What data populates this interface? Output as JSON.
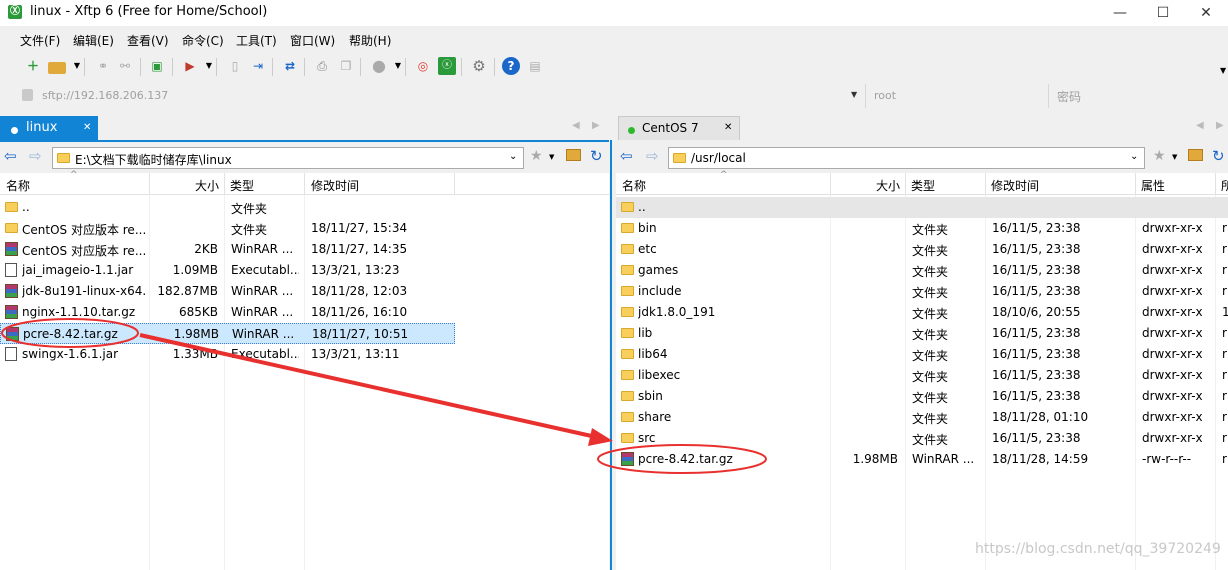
{
  "window": {
    "title": "linux - Xftp 6 (Free for Home/School)",
    "minimize": "—",
    "maximize": "☐",
    "close": "✕"
  },
  "menu": [
    "文件(F)",
    "编辑(E)",
    "查看(V)",
    "命令(C)",
    "工具(T)",
    "窗口(W)",
    "帮助(H)"
  ],
  "address": {
    "url": "sftp://192.168.206.137",
    "user": "root",
    "password_placeholder": "密码"
  },
  "left": {
    "tab": "linux",
    "path": "E:\\文档下载临时储存库\\linux",
    "columns": [
      "名称",
      "大小",
      "类型",
      "修改时间"
    ],
    "rows": [
      {
        "icon": "folder",
        "name": "..",
        "size": "",
        "type": "文件夹",
        "date": ""
      },
      {
        "icon": "folder",
        "name": "CentOS 对应版本 re...",
        "size": "",
        "type": "文件夹",
        "date": "18/11/27, 15:34"
      },
      {
        "icon": "rar",
        "name": "CentOS 对应版本 re...",
        "size": "2KB",
        "type": "WinRAR ...",
        "date": "18/11/27, 14:35"
      },
      {
        "icon": "jar",
        "name": "jai_imageio-1.1.jar",
        "size": "1.09MB",
        "type": "Executabl...",
        "date": "13/3/21, 13:23"
      },
      {
        "icon": "rar",
        "name": "jdk-8u191-linux-x64...",
        "size": "182.87MB",
        "type": "WinRAR ...",
        "date": "18/11/28, 12:03"
      },
      {
        "icon": "rar",
        "name": "nginx-1.1.10.tar.gz",
        "size": "685KB",
        "type": "WinRAR ...",
        "date": "18/11/26, 16:10"
      },
      {
        "icon": "rar",
        "name": "pcre-8.42.tar.gz",
        "size": "1.98MB",
        "type": "WinRAR ...",
        "date": "18/11/27, 10:51"
      },
      {
        "icon": "jar",
        "name": "swingx-1.6.1.jar",
        "size": "1.33MB",
        "type": "Executabl...",
        "date": "13/3/21, 13:11"
      }
    ]
  },
  "right": {
    "tab": "CentOS 7",
    "path": "/usr/local",
    "columns": [
      "名称",
      "大小",
      "类型",
      "修改时间",
      "属性",
      "所"
    ],
    "rows": [
      {
        "icon": "folder",
        "name": "..",
        "size": "",
        "type": "",
        "date": "",
        "attr": "",
        "owner": ""
      },
      {
        "icon": "folder",
        "name": "bin",
        "size": "",
        "type": "文件夹",
        "date": "16/11/5, 23:38",
        "attr": "drwxr-xr-x",
        "owner": "r"
      },
      {
        "icon": "folder",
        "name": "etc",
        "size": "",
        "type": "文件夹",
        "date": "16/11/5, 23:38",
        "attr": "drwxr-xr-x",
        "owner": "r"
      },
      {
        "icon": "folder",
        "name": "games",
        "size": "",
        "type": "文件夹",
        "date": "16/11/5, 23:38",
        "attr": "drwxr-xr-x",
        "owner": "r"
      },
      {
        "icon": "folder",
        "name": "include",
        "size": "",
        "type": "文件夹",
        "date": "16/11/5, 23:38",
        "attr": "drwxr-xr-x",
        "owner": "r"
      },
      {
        "icon": "folder",
        "name": "jdk1.8.0_191",
        "size": "",
        "type": "文件夹",
        "date": "18/10/6, 20:55",
        "attr": "drwxr-xr-x",
        "owner": "1"
      },
      {
        "icon": "folder",
        "name": "lib",
        "size": "",
        "type": "文件夹",
        "date": "16/11/5, 23:38",
        "attr": "drwxr-xr-x",
        "owner": "r"
      },
      {
        "icon": "folder",
        "name": "lib64",
        "size": "",
        "type": "文件夹",
        "date": "16/11/5, 23:38",
        "attr": "drwxr-xr-x",
        "owner": "r"
      },
      {
        "icon": "folder",
        "name": "libexec",
        "size": "",
        "type": "文件夹",
        "date": "16/11/5, 23:38",
        "attr": "drwxr-xr-x",
        "owner": "r"
      },
      {
        "icon": "folder",
        "name": "sbin",
        "size": "",
        "type": "文件夹",
        "date": "16/11/5, 23:38",
        "attr": "drwxr-xr-x",
        "owner": "r"
      },
      {
        "icon": "folder",
        "name": "share",
        "size": "",
        "type": "文件夹",
        "date": "18/11/28, 01:10",
        "attr": "drwxr-xr-x",
        "owner": "r"
      },
      {
        "icon": "folder",
        "name": "src",
        "size": "",
        "type": "文件夹",
        "date": "16/11/5, 23:38",
        "attr": "drwxr-xr-x",
        "owner": "r"
      },
      {
        "icon": "rar",
        "name": "pcre-8.42.tar.gz",
        "size": "1.98MB",
        "type": "WinRAR ...",
        "date": "18/11/28, 14:59",
        "attr": "-rw-r--r--",
        "owner": "r"
      }
    ]
  },
  "watermark": "https://blog.csdn.net/qq_39720249",
  "colors": {
    "accent": "#1184d6",
    "annotation": "#e8312f",
    "selection": "#cce8ff"
  }
}
